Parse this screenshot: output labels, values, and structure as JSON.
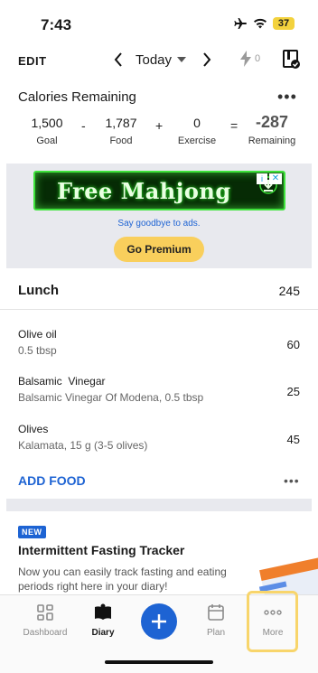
{
  "status_bar": {
    "time": "7:43",
    "battery": "37"
  },
  "topbar": {
    "edit_label": "EDIT",
    "date_label": "Today",
    "streak_count": "0"
  },
  "calories": {
    "title": "Calories Remaining",
    "goal": {
      "value": "1,500",
      "label": "Goal"
    },
    "op1": "-",
    "food": {
      "value": "1,787",
      "label": "Food"
    },
    "op2": "+",
    "exercise": {
      "value": "0",
      "label": "Exercise"
    },
    "op3": "=",
    "remaining": {
      "value": "-287",
      "label": "Remaining"
    }
  },
  "ad": {
    "banner_text": "Free Mahjong",
    "goodbye_text": "Say goodbye to ads.",
    "premium_button": "Go Premium"
  },
  "meal": {
    "name": "Lunch",
    "calories": "245",
    "items": [
      {
        "name": "Olive oil",
        "desc": "0.5 tbsp",
        "cal": "60"
      },
      {
        "name": "Balsamic  Vinegar",
        "desc": "Balsamic Vinegar Of Modena, 0.5 tbsp",
        "cal": "25"
      },
      {
        "name": "Olives",
        "desc": "Kalamata, 15 g (3-5 olives)",
        "cal": "45"
      }
    ],
    "add_food_label": "ADD FOOD"
  },
  "promo": {
    "badge": "NEW",
    "title": "Intermittent Fasting Tracker",
    "text": "Now you can easily track fasting and eating periods right here in your diary!"
  },
  "tabbar": {
    "tabs": [
      {
        "label": "Dashboard",
        "icon": "dashboard-icon"
      },
      {
        "label": "Diary",
        "icon": "diary-icon"
      },
      {
        "label": "",
        "icon": "plus-icon"
      },
      {
        "label": "Plan",
        "icon": "calendar-icon"
      },
      {
        "label": "More",
        "icon": "more-icon"
      }
    ]
  },
  "colors": {
    "accent": "#1d63d3",
    "premium": "#f9cf5c",
    "highlight": "#f8d56b"
  }
}
